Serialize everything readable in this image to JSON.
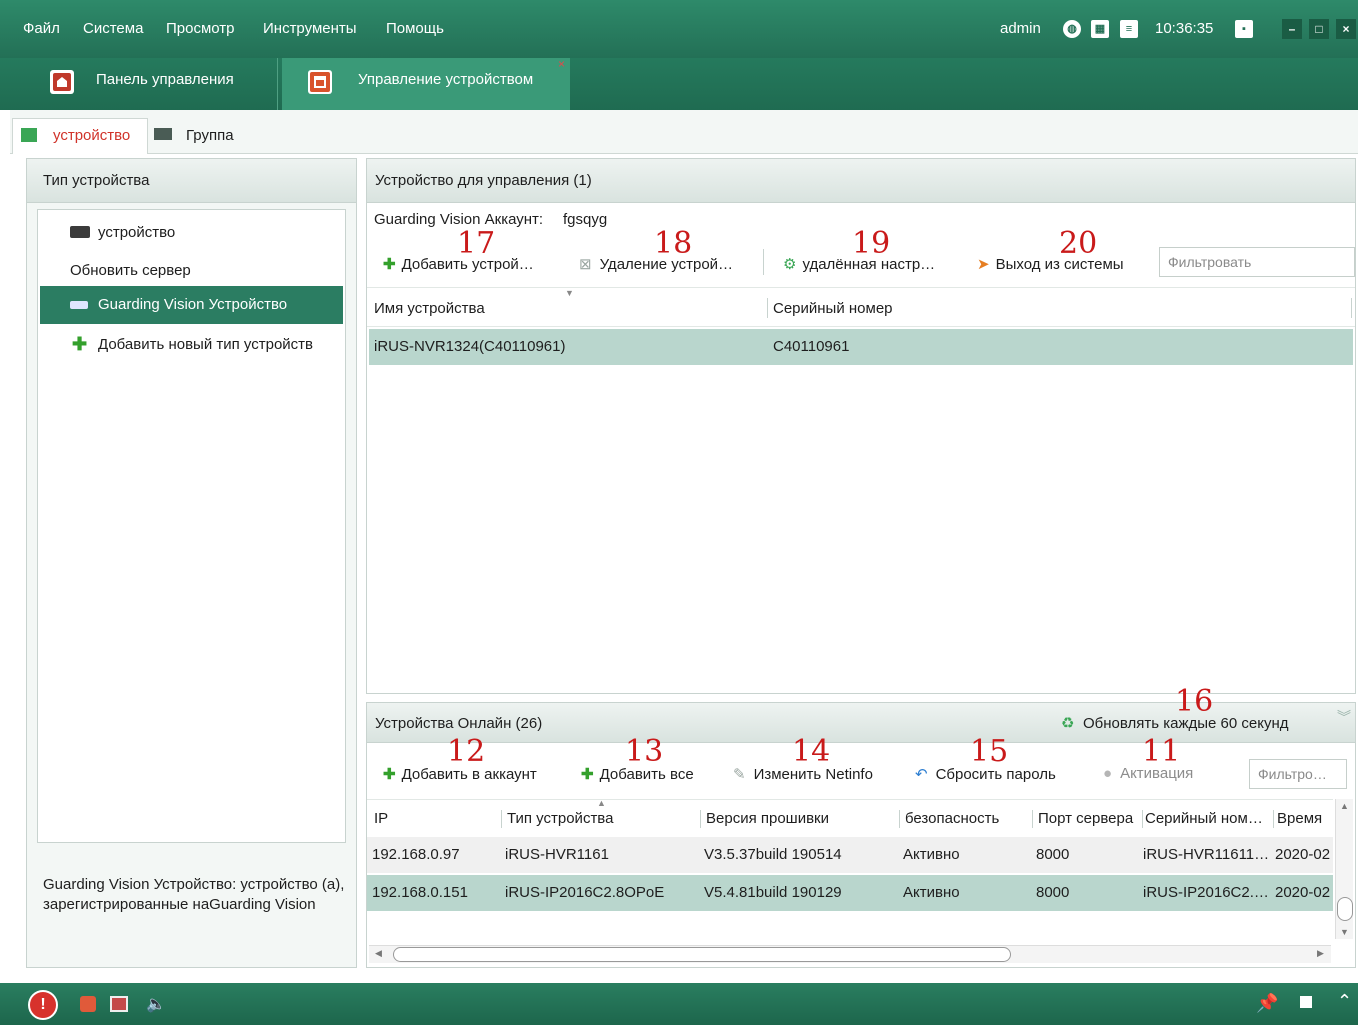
{
  "menubar": {
    "items": [
      "Файл",
      "Система",
      "Просмотр",
      "Инструменты",
      "Помощь"
    ],
    "user": "admin",
    "time": "10:36:35"
  },
  "module_tabs": [
    {
      "label": "Панель управления"
    },
    {
      "label": "Управление устройством"
    }
  ],
  "sub_tabs": [
    {
      "label": "устройство"
    },
    {
      "label": "Группа"
    }
  ],
  "left_panel": {
    "title": "Тип устройства",
    "items": [
      {
        "label": "устройство"
      },
      {
        "label": "Обновить сервер"
      },
      {
        "label": "Guarding Vision Устройство"
      },
      {
        "label": "Добавить новый тип устройств"
      }
    ],
    "description": "Guarding Vision Устройство: устройство (а), зарегистрированные наGuarding Vision"
  },
  "managed_panel": {
    "title": "Устройство для управления (1)",
    "account_label": "Guarding Vision Аккаунт:",
    "account_value": "fgsqyg",
    "toolbar": {
      "add": "Добавить устрой…",
      "delete": "Удаление устрой…",
      "remote": "удалённая настр…",
      "logout": "Выход из системы",
      "filter_placeholder": "Фильтровать"
    },
    "columns": [
      "Имя устройства",
      "Серийный номер"
    ],
    "rows": [
      {
        "name": "iRUS-NVR1324(C40110961)",
        "serial": "C40110961"
      }
    ]
  },
  "online_panel": {
    "title": "Устройства Онлайн (26)",
    "refresh": "Обновлять каждые 60 секунд",
    "toolbar": {
      "add_account": "Добавить в аккаунт",
      "add_all": "Добавить все",
      "netinfo": "Изменить Netinfo",
      "reset_pwd": "Сбросить пароль",
      "activate": "Активация",
      "filter_placeholder": "Фильтро…"
    },
    "columns": [
      "IP",
      "Тип устройства",
      "Версия прошивки",
      "безопасность",
      "Порт сервера",
      "Серийный ном…",
      "Время"
    ],
    "rows": [
      {
        "ip": "192.168.0.97",
        "type": "iRUS-HVR1161",
        "fw": "V3.5.37build 190514",
        "sec": "Активно",
        "port": "8000",
        "serial": "iRUS-HVR11611…",
        "time": "2020-02"
      },
      {
        "ip": "192.168.0.151",
        "type": "iRUS-IP2016C2.8OPoE",
        "fw": "V5.4.81build 190129",
        "sec": "Активно",
        "port": "8000",
        "serial": "iRUS-IP2016C2.…",
        "time": "2020-02"
      }
    ]
  },
  "annotations": [
    "17",
    "18",
    "19",
    "20",
    "16",
    "12",
    "13",
    "14",
    "15",
    "11"
  ],
  "colors": {
    "header_green": "#237056",
    "selected_row": "#b9d6cd",
    "selected_item": "#2b7d62",
    "annotation_red": "#c91a1a"
  }
}
